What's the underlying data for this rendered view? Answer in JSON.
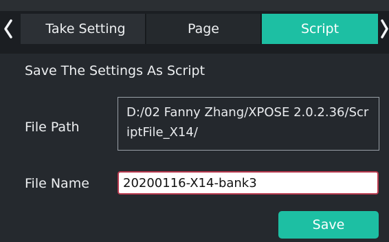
{
  "tabs": [
    {
      "label": "Take Setting"
    },
    {
      "label": "Page"
    },
    {
      "label": "Script"
    }
  ],
  "active_tab": "Script",
  "icons": {
    "nav_left": "chevron-left-icon",
    "nav_right": "chevron-right-icon"
  },
  "panel": {
    "title": "Save The Settings As Script",
    "file_path": {
      "label": "File Path",
      "value": "D:/02 Fanny Zhang/XPOSE 2.0.2.36/ScriptFile_X14/"
    },
    "file_name": {
      "label": "File Name",
      "value": "20200116-X14-bank3"
    },
    "save_label": "Save"
  },
  "colors": {
    "accent": "#1dbfa3",
    "background": "#25292e",
    "input_border_focus": "#b93a4f"
  }
}
